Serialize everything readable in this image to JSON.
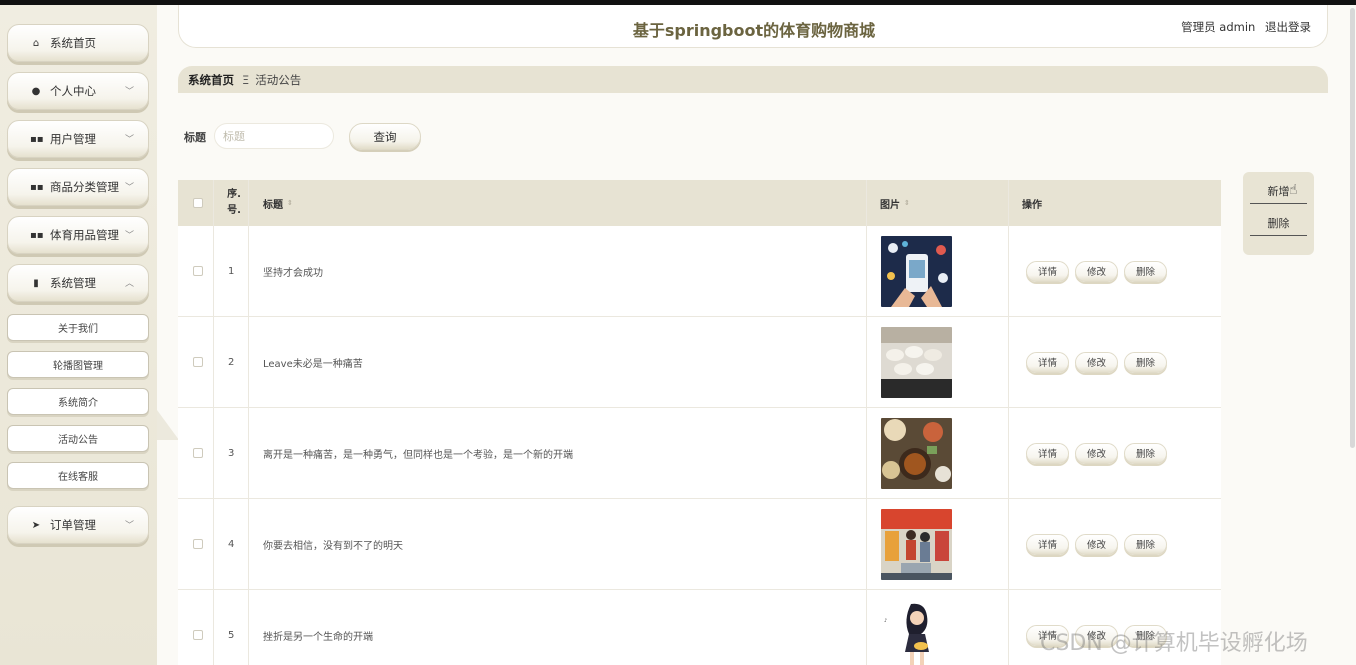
{
  "header": {
    "title": "基于springboot的体育购物商城",
    "user": "管理员 admin",
    "logout": "退出登录"
  },
  "sidebar": {
    "items": [
      {
        "label": "系统首页",
        "icon": "home-icon",
        "glyph": "⌂",
        "expandable": false
      },
      {
        "label": "个人中心",
        "icon": "user-icon",
        "glyph": "●",
        "expandable": true
      },
      {
        "label": "用户管理",
        "icon": "grid-icon",
        "glyph": "▪▪",
        "expandable": true
      },
      {
        "label": "商品分类管理",
        "icon": "grid-icon",
        "glyph": "▪▪",
        "expandable": true
      },
      {
        "label": "体育用品管理",
        "icon": "grid-icon",
        "glyph": "▪▪",
        "expandable": true
      },
      {
        "label": "系统管理",
        "icon": "bar-chart-icon",
        "glyph": "▮",
        "expandable": true,
        "expanded": true
      },
      {
        "label": "订单管理",
        "icon": "send-icon",
        "glyph": "➤",
        "expandable": true
      }
    ],
    "subitems": [
      "关于我们",
      "轮播图管理",
      "系统简介",
      "活动公告",
      "在线客服"
    ]
  },
  "breadcrumb": {
    "home": "系统首页",
    "separator": "Ξ",
    "current": "活动公告"
  },
  "search": {
    "label": "标题",
    "placeholder": "标题",
    "button": "查询"
  },
  "actions": {
    "add": "新增",
    "delete": "删除"
  },
  "table": {
    "columns": {
      "index": "序.号.",
      "title": "标题",
      "image": "图片",
      "ops": "操作"
    },
    "row_actions": {
      "detail": "详情",
      "edit": "修改",
      "delete": "删除"
    },
    "rows": [
      {
        "index": "1",
        "title": "坚持才会成功",
        "image": "phone-apps-image"
      },
      {
        "index": "2",
        "title": "Leave未必是一种痛苦",
        "image": "dumplings-image"
      },
      {
        "index": "3",
        "title": "离开是一种痛苦，是一种勇气，但同样也是一个考验，是一个新的开端",
        "image": "food-table-image"
      },
      {
        "index": "4",
        "title": "你要去相信，没有到不了的明天",
        "image": "shopping-illustration-image"
      },
      {
        "index": "5",
        "title": "挫折是另一个生命的开端",
        "image": "girl-illustration-image"
      }
    ]
  },
  "watermark": "CSDN @计算机毕设孵化场",
  "colors": {
    "accent": "#e7e3d3",
    "title": "#6b6440",
    "sidebar": "#f0ede1"
  }
}
